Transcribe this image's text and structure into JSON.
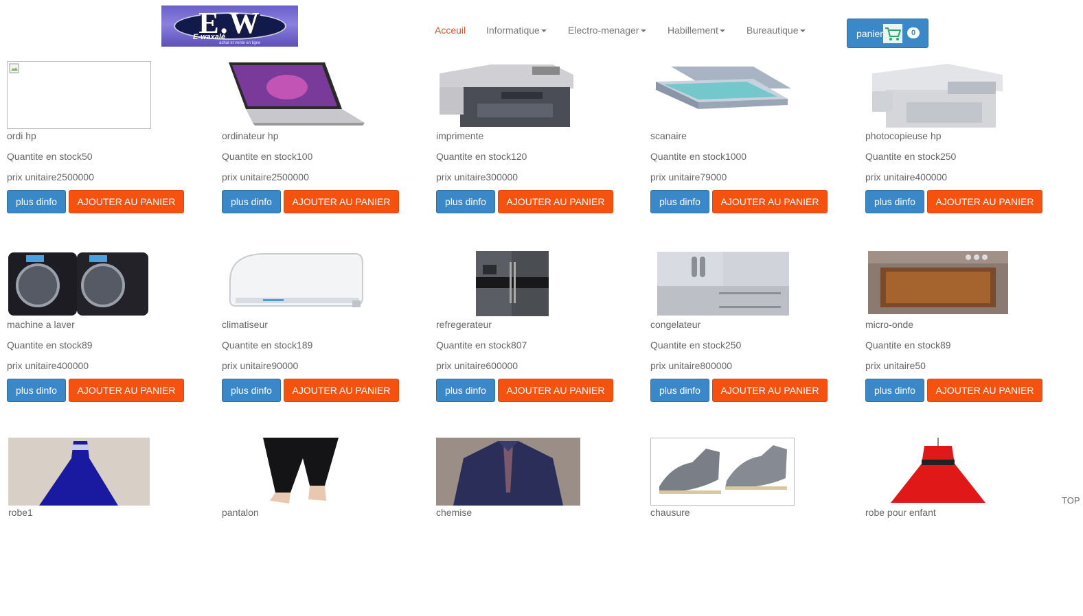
{
  "logo": {
    "letters": "E.W",
    "sub": "E-waxalé",
    "tag": "achat et vente en ligne"
  },
  "nav": [
    {
      "label": "Acceuil",
      "active": true
    },
    {
      "label": "Informatique",
      "dropdown": true
    },
    {
      "label": "Electro-menager",
      "dropdown": true
    },
    {
      "label": "Habillement",
      "dropdown": true
    },
    {
      "label": "Bureautique",
      "dropdown": true
    }
  ],
  "cart": {
    "label": "panier",
    "count": "0"
  },
  "buttons": {
    "info": "plus dinfo",
    "add": "AJOUTER AU PANIER"
  },
  "products": [
    {
      "name": "ordi hp",
      "stock": "Quantite en stock50",
      "price": "prix unitaire2500000",
      "img": "broken"
    },
    {
      "name": "ordinateur hp",
      "stock": "Quantite en stock100",
      "price": "prix unitaire2500000",
      "img": "laptop"
    },
    {
      "name": "imprimente",
      "stock": "Quantite en stock120",
      "price": "prix unitaire300000",
      "img": "printer"
    },
    {
      "name": "scanaire",
      "stock": "Quantite en stock1000",
      "price": "prix unitaire79000",
      "img": "scanner"
    },
    {
      "name": "photocopieuse hp",
      "stock": "Quantite en stock250",
      "price": "prix unitaire400000",
      "img": "copier"
    },
    {
      "name": "machine a laver",
      "stock": "Quantite en stock89",
      "price": "prix unitaire400000",
      "img": "washer"
    },
    {
      "name": "climatiseur",
      "stock": "Quantite en stock189",
      "price": "prix unitaire90000",
      "img": "aircon"
    },
    {
      "name": "refregerateur",
      "stock": "Quantite en stock807",
      "price": "prix unitaire600000",
      "img": "fridge"
    },
    {
      "name": "congelateur",
      "stock": "Quantite en stock250",
      "price": "prix unitaire800000",
      "img": "freezer"
    },
    {
      "name": "micro-onde",
      "stock": "Quantite en stock89",
      "price": "prix unitaire50",
      "img": "microwave"
    },
    {
      "name": "robe1",
      "img": "dress"
    },
    {
      "name": "pantalon",
      "img": "pants"
    },
    {
      "name": "chemise",
      "img": "shirt"
    },
    {
      "name": "chausure",
      "img": "shoes"
    },
    {
      "name": "robe pour enfant",
      "img": "kiddress"
    }
  ],
  "footer": {
    "top_link": "TOP"
  }
}
